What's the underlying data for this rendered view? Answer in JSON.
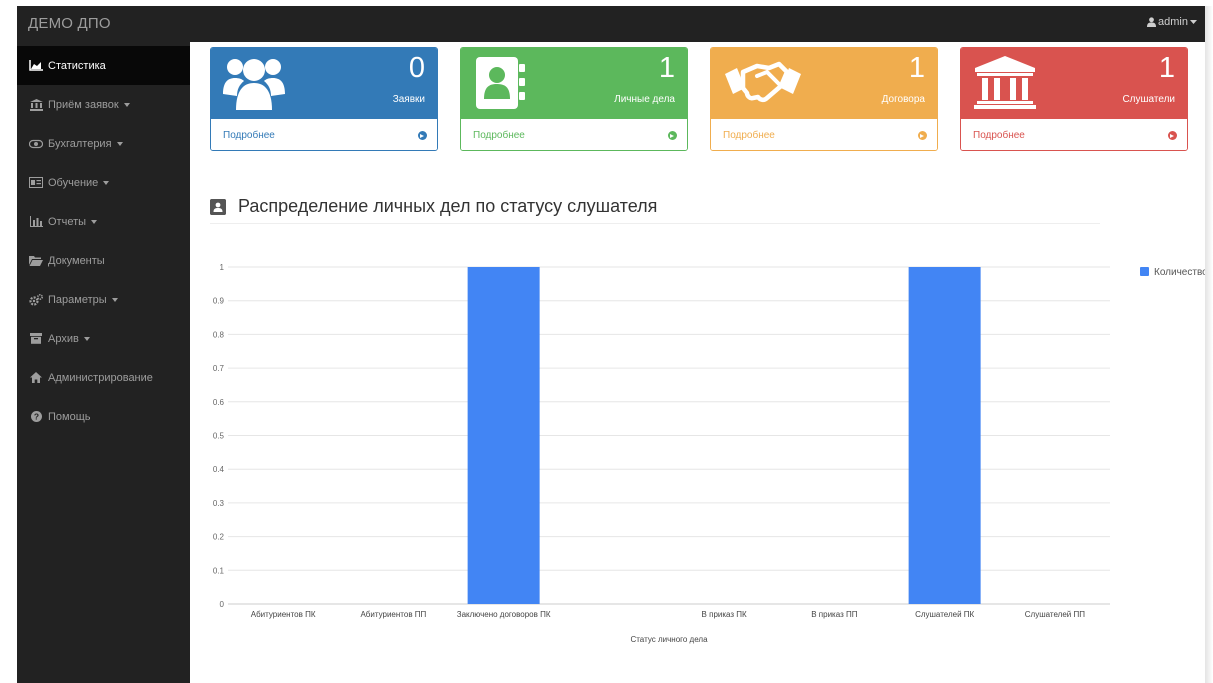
{
  "navbar": {
    "brand": "ДЕМО ДПО",
    "user": "admin"
  },
  "sidebar": {
    "items": [
      {
        "label": "Статистика",
        "icon": "area-chart-icon",
        "active": true,
        "caret": false
      },
      {
        "label": "Приём заявок",
        "icon": "bank-icon",
        "active": false,
        "caret": true
      },
      {
        "label": "Бухгалтерия",
        "icon": "money-icon",
        "active": false,
        "caret": true
      },
      {
        "label": "Обучение",
        "icon": "id-card-icon",
        "active": false,
        "caret": true
      },
      {
        "label": "Отчеты",
        "icon": "bar-chart-icon",
        "active": false,
        "caret": true
      },
      {
        "label": "Документы",
        "icon": "folder-open-icon",
        "active": false,
        "caret": false
      },
      {
        "label": "Параметры",
        "icon": "cogs-icon",
        "active": false,
        "caret": true
      },
      {
        "label": "Архив",
        "icon": "archive-icon",
        "active": false,
        "caret": true
      },
      {
        "label": "Администрирование",
        "icon": "home-icon",
        "active": false,
        "caret": false
      },
      {
        "label": "Помощь",
        "icon": "question-circle-icon",
        "active": false,
        "caret": false
      }
    ]
  },
  "cards": [
    {
      "count": "0",
      "label": "Заявки",
      "link": "Подробнее",
      "icon": "users-icon",
      "color": "#337ab7"
    },
    {
      "count": "1",
      "label": "Личные дела",
      "link": "Подробнее",
      "icon": "address-book-icon",
      "color": "#5cb85c"
    },
    {
      "count": "1",
      "label": "Договора",
      "link": "Подробнее",
      "icon": "handshake-icon",
      "color": "#f0ad4e"
    },
    {
      "count": "1",
      "label": "Слушатели",
      "link": "Подробнее",
      "icon": "university-icon",
      "color": "#d9534f"
    }
  ],
  "section": {
    "title": "Распределение личных дел по статусу слушателя",
    "icon": "address-book-icon"
  },
  "chart_data": {
    "type": "bar",
    "title": "",
    "xlabel": "Статус личного дела",
    "ylabel": "",
    "ylim": [
      0,
      1
    ],
    "yticks": [
      "0",
      "0.1",
      "0.2",
      "0.3",
      "0.4",
      "0.5",
      "0.6",
      "0.7",
      "0.8",
      "0.9",
      "1"
    ],
    "categories": [
      "Абитуриентов ПК",
      "Абитуриентов ПП",
      "Заключено договоров ПК",
      "",
      "В приказ ПК",
      "В приказ ПП",
      "Слушателей ПК",
      "Слушателей ПП"
    ],
    "series": [
      {
        "name": "Количество",
        "values": [
          0,
          0,
          1,
          0,
          0,
          0,
          1,
          0
        ],
        "color": "#4285f4"
      }
    ],
    "grid": true,
    "legend": "right"
  }
}
